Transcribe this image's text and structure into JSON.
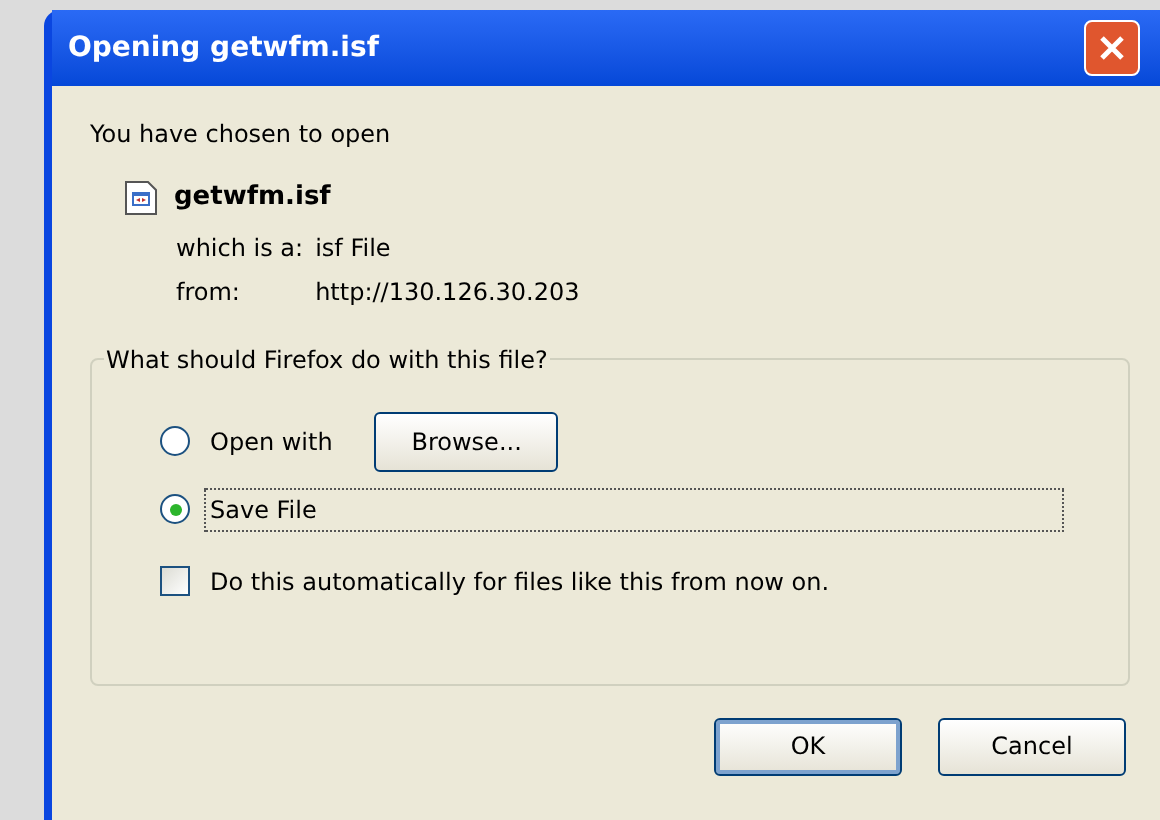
{
  "window": {
    "title": "Opening getwfm.isf"
  },
  "intro": "You have chosen to open",
  "file": {
    "name": "getwfm.isf",
    "type_label": "which is a:",
    "type": "isf File",
    "from_label": "from:",
    "from": "http://130.126.30.203"
  },
  "group": {
    "label": "What should Firefox do with this file?",
    "options": [
      {
        "label": "Open with",
        "selected": false,
        "focused": false,
        "button": "Browse..."
      },
      {
        "label": "Save File",
        "selected": true,
        "focused": true
      }
    ],
    "auto": {
      "label": "Do this automatically for files like this from now on.",
      "checked": false
    }
  },
  "buttons": [
    {
      "label": "OK",
      "default": true
    },
    {
      "label": "Cancel",
      "default": false
    }
  ]
}
